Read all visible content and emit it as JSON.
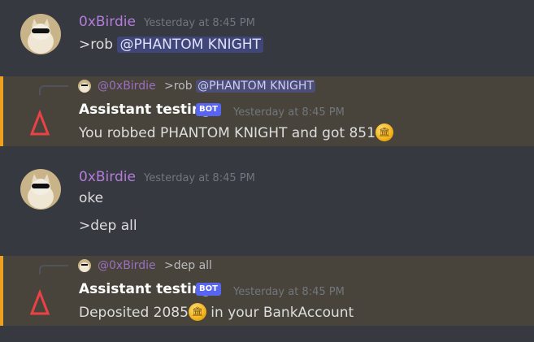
{
  "messages": [
    {
      "author": "0xBirdie",
      "timestamp": "Yesterday at 8:45 PM",
      "lines": [
        {
          "prefix": ">rob ",
          "mention": "@PHANTOM KNIGHT"
        }
      ]
    },
    {
      "reply": {
        "author": "@0xBirdie",
        "prefix": ">rob ",
        "mention": "@PHANTOM KNIGHT"
      },
      "author": "Assistant testing",
      "badge": "BOT",
      "timestamp": "Yesterday at 8:45 PM",
      "text_before": "You robbed PHANTOM KNIGHT and got 851",
      "text_after": ""
    },
    {
      "author": "0xBirdie",
      "timestamp": "Yesterday at 8:45 PM",
      "lines": [
        {
          "text": "oke"
        },
        {
          "text": ">dep all"
        }
      ]
    },
    {
      "reply": {
        "author": "@0xBirdie",
        "prefix": ">dep all"
      },
      "author": "Assistant testing",
      "badge": "BOT",
      "timestamp": "Yesterday at 8:45 PM",
      "text_before": "Deposited 2085",
      "text_after": " in your BankAccount"
    }
  ],
  "icons": {
    "coin": "bank-coin-emoji",
    "bot_avatar": "red-delta-logo",
    "user_avatar": "cat-with-sunglasses"
  },
  "colors": {
    "background": "#36393f",
    "username": "#b47ddb",
    "mention_bg": "#4a4f8f",
    "highlight_border": "#f0a020",
    "bot_badge": "#5865f2",
    "bot_logo": "#ed4245"
  }
}
